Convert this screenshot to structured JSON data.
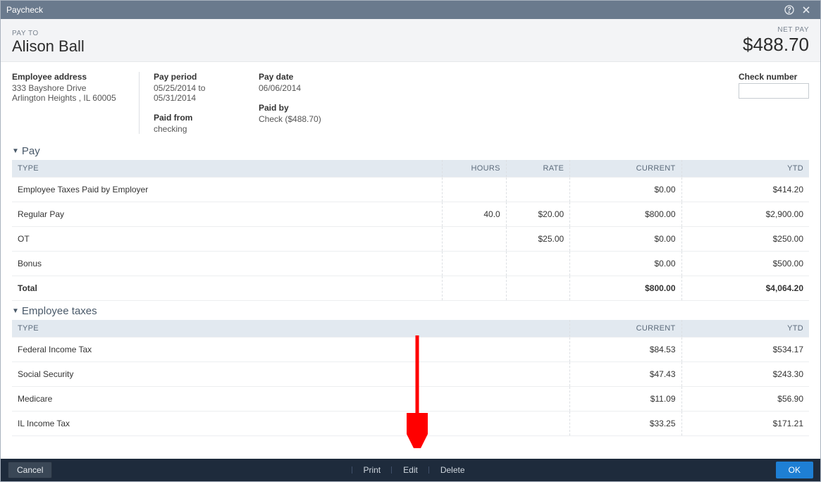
{
  "titlebar": {
    "title": "Paycheck"
  },
  "header": {
    "payto_label": "PAY TO",
    "payto_name": "Alison Ball",
    "netpay_label": "NET PAY",
    "netpay_amount": "$488.70"
  },
  "info": {
    "employee_address_label": "Employee address",
    "employee_address_line1": "333 Bayshore Drive",
    "employee_address_line2": "Arlington Heights , IL 60005",
    "pay_period_label": "Pay period",
    "pay_period_value": "05/25/2014 to 05/31/2014",
    "paid_from_label": "Paid from",
    "paid_from_value": "checking",
    "pay_date_label": "Pay date",
    "pay_date_value": "06/06/2014",
    "paid_by_label": "Paid by",
    "paid_by_value": "Check ($488.70)",
    "check_number_label": "Check number",
    "check_number_value": ""
  },
  "pay_section": {
    "title": "Pay",
    "cols": {
      "type": "TYPE",
      "hours": "HOURS",
      "rate": "RATE",
      "current": "CURRENT",
      "ytd": "YTD"
    },
    "rows": [
      {
        "type": "Employee Taxes Paid by Employer",
        "hours": "",
        "rate": "",
        "current": "$0.00",
        "ytd": "$414.20"
      },
      {
        "type": "Regular Pay",
        "hours": "40.0",
        "rate": "$20.00",
        "current": "$800.00",
        "ytd": "$2,900.00"
      },
      {
        "type": "OT",
        "hours": "",
        "rate": "$25.00",
        "current": "$0.00",
        "ytd": "$250.00"
      },
      {
        "type": "Bonus",
        "hours": "",
        "rate": "",
        "current": "$0.00",
        "ytd": "$500.00"
      }
    ],
    "total": {
      "label": "Total",
      "current": "$800.00",
      "ytd": "$4,064.20"
    }
  },
  "tax_section": {
    "title": "Employee taxes",
    "cols": {
      "type": "TYPE",
      "current": "CURRENT",
      "ytd": "YTD"
    },
    "rows": [
      {
        "type": "Federal Income Tax",
        "current": "$84.53",
        "ytd": "$534.17"
      },
      {
        "type": "Social Security",
        "current": "$47.43",
        "ytd": "$243.30"
      },
      {
        "type": "Medicare",
        "current": "$11.09",
        "ytd": "$56.90"
      },
      {
        "type": "IL Income Tax",
        "current": "$33.25",
        "ytd": "$171.21"
      }
    ]
  },
  "footer": {
    "cancel": "Cancel",
    "print": "Print",
    "edit": "Edit",
    "delete": "Delete",
    "ok": "OK"
  }
}
